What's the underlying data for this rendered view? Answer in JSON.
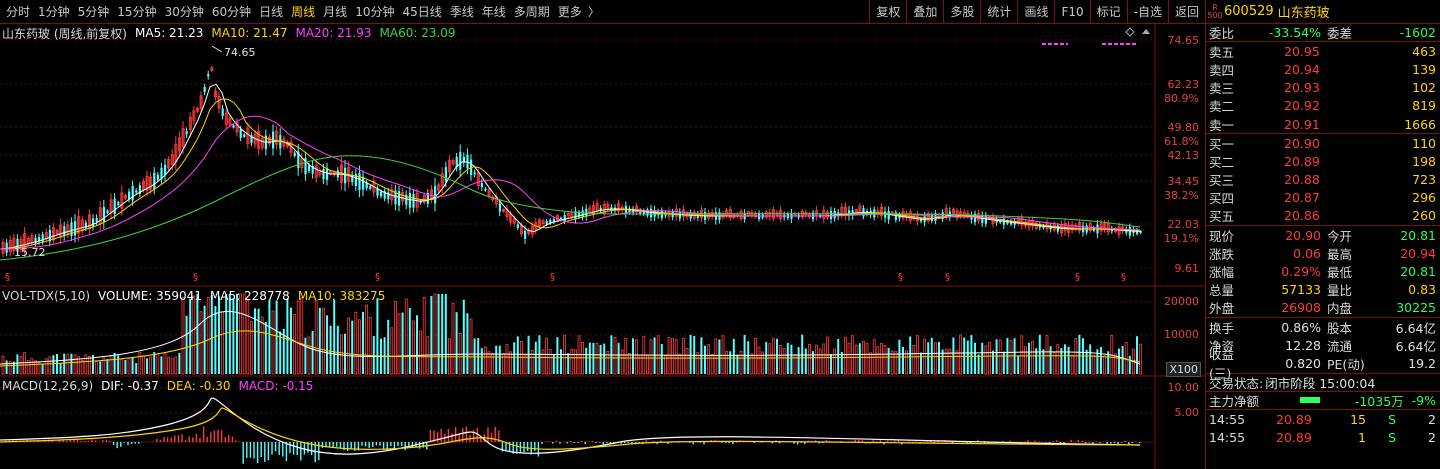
{
  "toolbar": {
    "periods": [
      "分时",
      "1分钟",
      "5分钟",
      "15分钟",
      "30分钟",
      "60分钟",
      "日线",
      "周线",
      "月线",
      "10分钟",
      "45日线",
      "季线",
      "年线",
      "多周期",
      "更多"
    ],
    "active_period": "周线",
    "arrow": "〉",
    "buttons": [
      "复权",
      "叠加",
      "多股",
      "统计",
      "画线",
      "F10",
      "标记",
      "-自选",
      "返回"
    ]
  },
  "main_chart": {
    "title": "山东药玻 (周线,前复权)",
    "ma5": "MA5: 21.23",
    "ma10": "MA10: 21.47",
    "ma20": "MA20: 21.93",
    "ma60": "MA60: 23.09",
    "high_label": "74.65",
    "low_label": "15.72",
    "y_labels": [
      "74.65",
      "62.23",
      "80.9%",
      "49.80",
      "61.8%",
      "42.13",
      "34.45",
      "38.2%",
      "22.03",
      "19.1%",
      "9.61"
    ],
    "colors": {
      "ma5": "#ffffff",
      "ma10": "#ffd400",
      "ma20": "#ff40ff",
      "ma60": "#3cd23c"
    }
  },
  "volume_chart": {
    "title": "VOL-TDX(5,10)",
    "volume": "VOLUME: 359041",
    "ma5": "MA5: 228778",
    "ma10": "MA10: 383275",
    "y_labels": [
      "20000",
      "10000"
    ],
    "unit": "X100"
  },
  "macd_chart": {
    "title": "MACD(12,26,9)",
    "dif": "DIF: -0.37",
    "dea": "DEA: -0.30",
    "macd": "MACD: -0.15",
    "y_labels": [
      "10.00",
      "5.00"
    ]
  },
  "quote": {
    "rz_top": "R",
    "rz_bottom": "500",
    "code": "600529",
    "name": "山东药玻",
    "weibi_label": "委比",
    "weibi": "-33.54%",
    "weicha_label": "委差",
    "weicha": "-1602",
    "sells": [
      {
        "label": "卖五",
        "price": "20.95",
        "vol": "463"
      },
      {
        "label": "卖四",
        "price": "20.94",
        "vol": "139"
      },
      {
        "label": "卖三",
        "price": "20.93",
        "vol": "102"
      },
      {
        "label": "卖二",
        "price": "20.92",
        "vol": "819"
      },
      {
        "label": "卖一",
        "price": "20.91",
        "vol": "1666"
      }
    ],
    "buys": [
      {
        "label": "买一",
        "price": "20.90",
        "vol": "110"
      },
      {
        "label": "买二",
        "price": "20.89",
        "vol": "198"
      },
      {
        "label": "买三",
        "price": "20.88",
        "vol": "723"
      },
      {
        "label": "买四",
        "price": "20.87",
        "vol": "296"
      },
      {
        "label": "买五",
        "price": "20.86",
        "vol": "260"
      }
    ],
    "stats": [
      {
        "l1": "现价",
        "v1": "20.90",
        "c1": "red",
        "l2": "今开",
        "v2": "20.81",
        "c2": "green"
      },
      {
        "l1": "涨跌",
        "v1": "0.06",
        "c1": "red",
        "l2": "最高",
        "v2": "20.94",
        "c2": "red"
      },
      {
        "l1": "涨幅",
        "v1": "0.29%",
        "c1": "red",
        "l2": "最低",
        "v2": "20.81",
        "c2": "green"
      },
      {
        "l1": "总量",
        "v1": "57133",
        "c1": "yellow",
        "l2": "量比",
        "v2": "0.83",
        "c2": "yellow"
      },
      {
        "l1": "外盘",
        "v1": "26908",
        "c1": "red",
        "l2": "内盘",
        "v2": "30225",
        "c2": "green"
      }
    ],
    "stats2": [
      {
        "l1": "换手",
        "v1": "0.86%",
        "l2": "股本",
        "v2": "6.64亿"
      },
      {
        "l1": "净资",
        "v1": "12.28",
        "l2": "流通",
        "v2": "6.64亿"
      },
      {
        "l1": "收益(三)",
        "v1": "0.820",
        "l2": "PE(动)",
        "v2": "19.2"
      }
    ],
    "trade_status_label": "交易状态:",
    "trade_status": "闭市阶段 15:00:04",
    "main_flow_label": "主力净额",
    "main_flow": "-1035万",
    "main_flow_pct": "-9%",
    "ticks": [
      {
        "time": "14:55",
        "price": "20.89",
        "vol": "15",
        "side": "S",
        "n": "2"
      },
      {
        "time": "14:55",
        "price": "20.89",
        "vol": "1",
        "side": "S",
        "n": "2"
      }
    ]
  }
}
